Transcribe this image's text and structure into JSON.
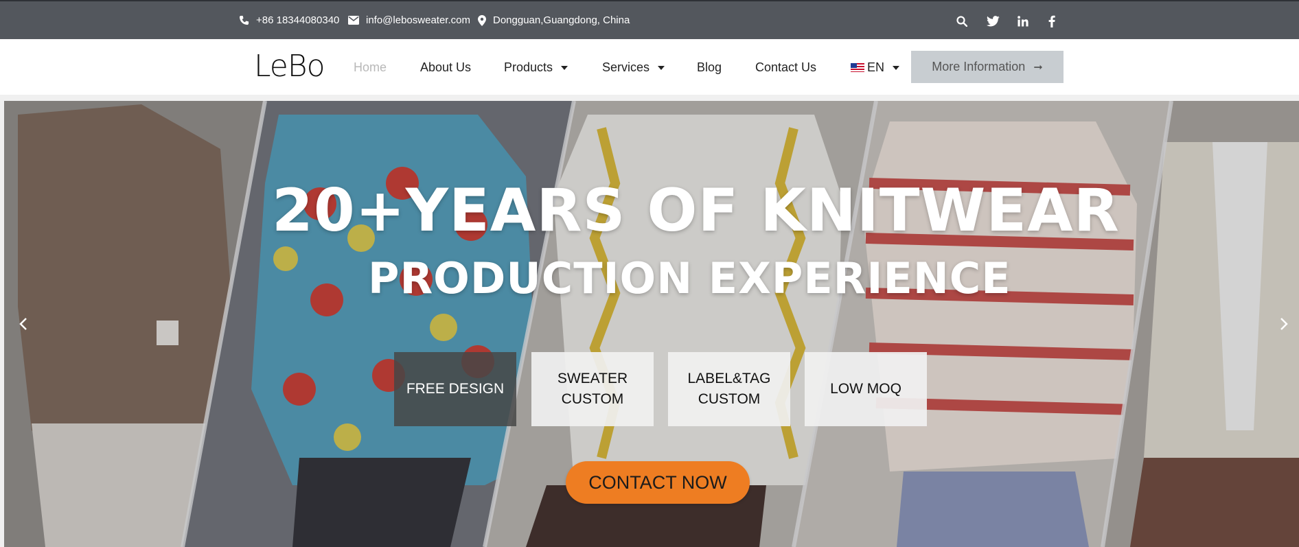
{
  "topbar": {
    "phone": "+86 18344080340",
    "email": "info@lebosweater.com",
    "address": "Dongguan,Guangdong, China",
    "icons": [
      "phone-icon",
      "mail-icon",
      "location-pin-icon",
      "search-icon",
      "twitter-icon",
      "linkedin-icon",
      "facebook-icon"
    ]
  },
  "nav": {
    "logo": "LeBo",
    "items": [
      "Home",
      "About Us",
      "Products",
      "Services",
      "Blog",
      "Contact Us"
    ],
    "language": "EN",
    "more_label": "More Information"
  },
  "hero": {
    "headline": "20+YEARS OF KNITWEAR",
    "subheadline": "PRODUCTION EXPERIENCE",
    "features": [
      {
        "line1": "FREE DESIGN",
        "line2": ""
      },
      {
        "line1": "SWEATER",
        "line2": "CUSTOM"
      },
      {
        "line1": "LABEL&TAG",
        "line2": "CUSTOM"
      },
      {
        "line1": "LOW MOQ",
        "line2": ""
      }
    ],
    "cta_label": "CONTACT NOW"
  },
  "colors": {
    "topbar_bg": "#53575d",
    "cta_orange": "#ee7d22",
    "more_btn_bg": "#c8cdd1"
  }
}
